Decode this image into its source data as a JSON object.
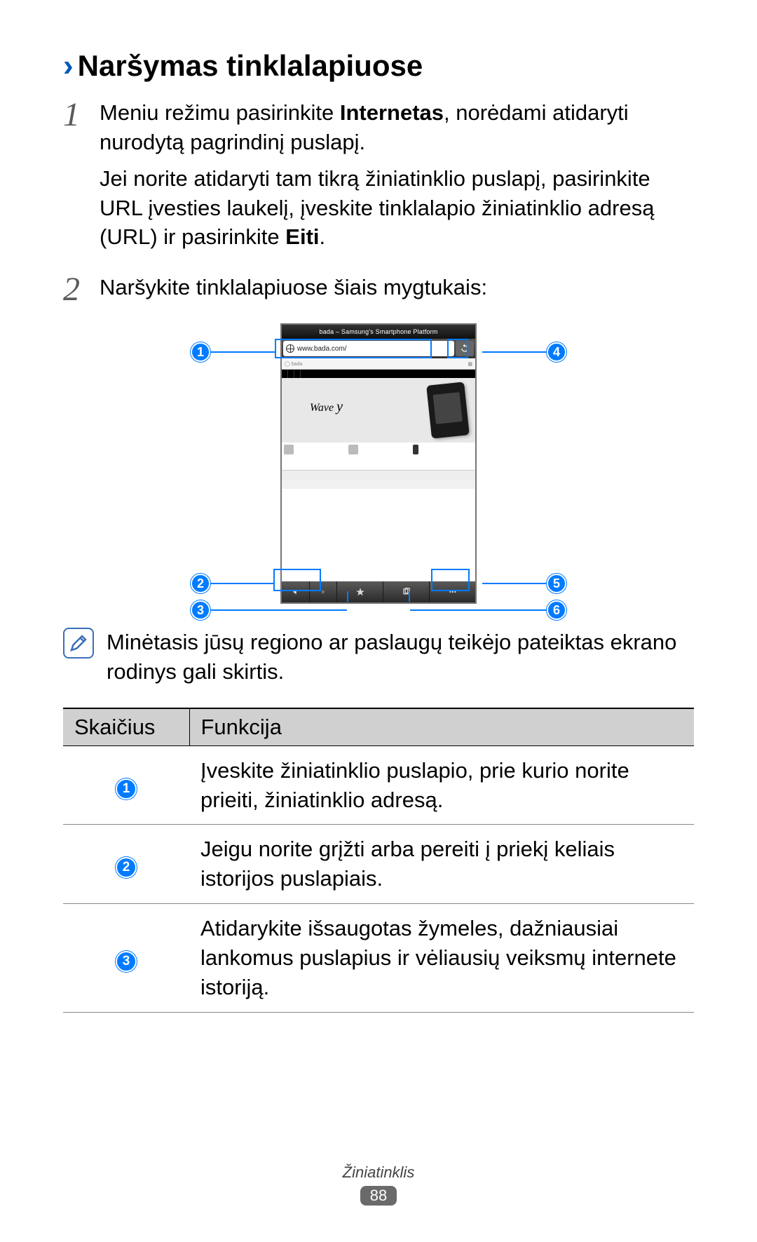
{
  "heading": {
    "chevron": "›",
    "text": "Naršymas tinklalapiuose"
  },
  "steps": [
    {
      "num": "1",
      "para1_a": "Meniu režimu pasirinkite ",
      "para1_bold": "Internetas",
      "para1_b": ", norėdami atidaryti nurodytą pagrindinį puslapį.",
      "para2_a": "Jei norite atidaryti tam tikrą žiniatinklio puslapį, pasirinkite URL įvesties laukelį, įveskite tinklalapio žiniatinklio adresą (URL) ir pasirinkite ",
      "para2_bold": "Eiti",
      "para2_b": "."
    },
    {
      "num": "2",
      "para1_a": "Naršykite tinklalapiuose šiais mygtukais:"
    }
  ],
  "phone": {
    "title": "bada – Samsung's Smartphone Platform",
    "url": "www.bada.com/",
    "hero_brand": "Wave",
    "hero_model": "y",
    "banner_left": "bada"
  },
  "callouts": {
    "1": "1",
    "2": "2",
    "3": "3",
    "4": "4",
    "5": "5",
    "6": "6"
  },
  "note": "Minėtasis jūsų regiono ar paslaugų teikėjo pateiktas ekrano rodinys gali skirtis.",
  "table": {
    "headers": {
      "col1": "Skaičius",
      "col2": "Funkcija"
    },
    "rows": [
      {
        "n": "1",
        "t": "Įveskite žiniatinklio puslapio, prie kurio norite prieiti, žiniatinklio adresą."
      },
      {
        "n": "2",
        "t": "Jeigu norite grįžti arba pereiti į priekį keliais istorijos puslapiais."
      },
      {
        "n": "3",
        "t": "Atidarykite išsaugotas žymeles, dažniausiai lankomus puslapius ir vėliausių veiksmų internete istoriją."
      }
    ]
  },
  "footer": {
    "section": "Žiniatinklis",
    "page": "88"
  }
}
